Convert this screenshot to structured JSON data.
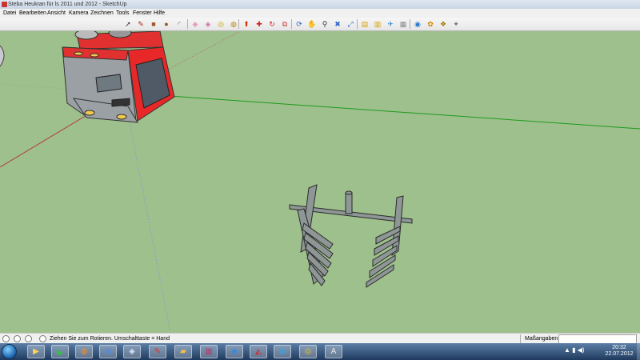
{
  "window": {
    "title": "Steba Heukran für ls 2011 und 2012 - SketchUp"
  },
  "menu": [
    "Datei",
    "Bearbeiten",
    "Ansicht",
    "Kamera",
    "Zeichnen",
    "Tools",
    "Fenster",
    "Hilfe"
  ],
  "toolbar": {
    "tools": [
      {
        "name": "select-icon",
        "glyph": "➚",
        "color": "#333333"
      },
      {
        "name": "pencil-icon",
        "glyph": "✎",
        "color": "#b22222"
      },
      {
        "name": "rectangle-icon",
        "glyph": "■",
        "color": "#a0522d"
      },
      {
        "name": "circle-icon",
        "glyph": "●",
        "color": "#8b5a2b"
      },
      {
        "name": "arc-icon",
        "glyph": "◜",
        "color": "#555555"
      },
      {
        "name": "eraser-icon",
        "glyph": "◆",
        "color": "#e8a0c0"
      },
      {
        "name": "eraser-pink-icon",
        "glyph": "◈",
        "color": "#d070a0"
      },
      {
        "name": "tape-measure-icon",
        "glyph": "◎",
        "color": "#c8a000"
      },
      {
        "name": "paint-bucket-icon",
        "glyph": "◍",
        "color": "#b8860b"
      },
      {
        "name": "push-pull-icon",
        "glyph": "⬆",
        "color": "#cc3300"
      },
      {
        "name": "move-icon",
        "glyph": "✚",
        "color": "#cc2222"
      },
      {
        "name": "rotate-icon",
        "glyph": "↻",
        "color": "#cc2222"
      },
      {
        "name": "offset-icon",
        "glyph": "⧉",
        "color": "#cc3333"
      },
      {
        "name": "orbit-icon",
        "glyph": "⟳",
        "color": "#3366cc"
      },
      {
        "name": "pan-icon",
        "glyph": "✋",
        "color": "#446699"
      },
      {
        "name": "zoom-icon",
        "glyph": "⚲",
        "color": "#333333"
      },
      {
        "name": "zoom-window-icon",
        "glyph": "✖",
        "color": "#3366cc"
      },
      {
        "name": "zoom-extents-icon",
        "glyph": "⤢",
        "color": "#3366cc"
      },
      {
        "name": "3d-warehouse-icon",
        "glyph": "▤",
        "color": "#d4a000"
      },
      {
        "name": "share-model-icon",
        "glyph": "▥",
        "color": "#d4a000"
      },
      {
        "name": "get-models-icon",
        "glyph": "✈",
        "color": "#3388cc"
      },
      {
        "name": "components-icon",
        "glyph": "▦",
        "color": "#888888"
      },
      {
        "name": "google-earth-icon",
        "glyph": "◉",
        "color": "#2277cc"
      },
      {
        "name": "styles-icon",
        "glyph": "✿",
        "color": "#cc8800"
      },
      {
        "name": "materials-icon",
        "glyph": "❖",
        "color": "#aa7700"
      },
      {
        "name": "extension-icon",
        "glyph": "✦",
        "color": "#777777"
      }
    ]
  },
  "statusbar": {
    "hint": "Ziehen Sie zum Rotieren.  Umschalttaste = Hand",
    "measure_label": "Maßangaben",
    "measure_value": ""
  },
  "taskbar": {
    "apps": [
      {
        "name": "windows-explorer-icon",
        "glyph": "▶",
        "color": "#ffd25a"
      },
      {
        "name": "stock-app-icon",
        "glyph": "◣",
        "color": "#2ec43e"
      },
      {
        "name": "firefox-icon",
        "glyph": "◍",
        "color": "#ff8a1c"
      },
      {
        "name": "media-icon",
        "glyph": "▣",
        "color": "#5a8ad0"
      },
      {
        "name": "layers-app-icon",
        "glyph": "◈",
        "color": "#d8e8f8"
      },
      {
        "name": "sketchup-icon",
        "glyph": "✎",
        "color": "#e03030"
      },
      {
        "name": "folder-app-icon",
        "glyph": "▰",
        "color": "#f0c040"
      },
      {
        "name": "winrar-icon",
        "glyph": "▦",
        "color": "#b04070"
      },
      {
        "name": "shield-app-icon",
        "glyph": "◆",
        "color": "#3a8ad8"
      },
      {
        "name": "car-game-icon",
        "glyph": "◭",
        "color": "#d03030"
      },
      {
        "name": "earth-icon",
        "glyph": "◉",
        "color": "#3aa0e0"
      },
      {
        "name": "chrome-icon",
        "glyph": "◎",
        "color": "#e8c020"
      },
      {
        "name": "font-app-icon",
        "glyph": "A",
        "color": "#e8e8e8"
      }
    ],
    "tray_glyphs": "▲ ▮ ◀)",
    "time": "20:32",
    "date": "22.07.2012"
  }
}
